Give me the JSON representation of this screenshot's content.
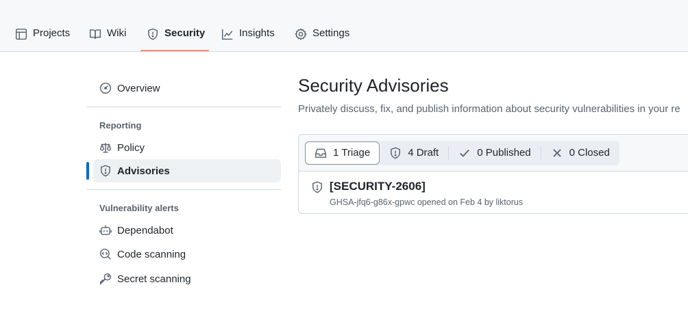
{
  "nav": {
    "tabs": [
      {
        "label": "Projects",
        "icon": "table-icon"
      },
      {
        "label": "Wiki",
        "icon": "book-icon"
      },
      {
        "label": "Security",
        "icon": "shield-icon"
      },
      {
        "label": "Insights",
        "icon": "graph-icon"
      },
      {
        "label": "Settings",
        "icon": "gear-icon"
      }
    ],
    "active_tab": "Security",
    "underline_color": "#fd8c73"
  },
  "sidebar": {
    "overview": "Overview",
    "reporting_heading": "Reporting",
    "policy": "Policy",
    "advisories": "Advisories",
    "vulnerability_heading": "Vulnerability alerts",
    "dependabot": "Dependabot",
    "code_scanning": "Code scanning",
    "secret_scanning": "Secret scanning",
    "active_item": "Advisories",
    "accent_color": "#0969da"
  },
  "main": {
    "title": "Security Advisories",
    "description": "Privately discuss, fix, and publish information about security vulnerabilities in your re"
  },
  "filters": {
    "triage": "1 Triage",
    "draft": "4 Draft",
    "published": "0 Published",
    "closed": "0 Closed",
    "selected": "triage"
  },
  "advisory": {
    "title": "[SECURITY-2606]",
    "meta": "GHSA-jfq6-g86x-gpwc opened on Feb 4 by liktorus"
  }
}
